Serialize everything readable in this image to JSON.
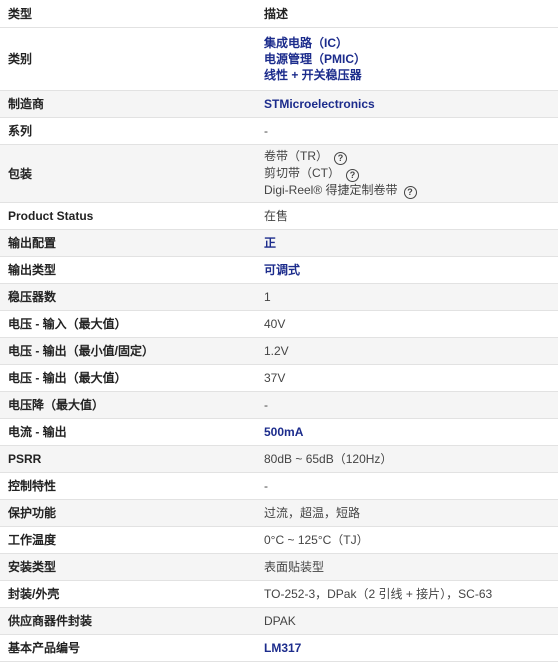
{
  "header": {
    "col1": "类型",
    "col2": "描述"
  },
  "rows": [
    {
      "label": "类别",
      "values": [
        "集成电路（IC）",
        "电源管理（PMIC）",
        "线性 + 开关稳压器"
      ]
    },
    {
      "label": "制造商",
      "value": "STMicroelectronics"
    },
    {
      "label": "系列",
      "value": "-"
    },
    {
      "label": "包装",
      "values": [
        "卷带（TR）",
        "剪切带（CT）",
        "Digi-Reel® 得捷定制卷带"
      ],
      "icon": "question-circle-icon"
    },
    {
      "label": "Product Status",
      "value": "在售"
    },
    {
      "label": "输出配置",
      "value": "正"
    },
    {
      "label": "输出类型",
      "value": "可调式"
    },
    {
      "label": "稳压器数",
      "value": "1"
    },
    {
      "label": "电压 - 输入（最大值）",
      "value": "40V"
    },
    {
      "label": "电压 - 输出（最小值/固定）",
      "value": "1.2V"
    },
    {
      "label": "电压 - 输出（最大值）",
      "value": "37V"
    },
    {
      "label": "电压降（最大值）",
      "value": "-"
    },
    {
      "label": "电流 - 输出",
      "value": "500mA"
    },
    {
      "label": "PSRR",
      "value": "80dB ~ 65dB（120Hz）"
    },
    {
      "label": "控制特性",
      "value": "-"
    },
    {
      "label": "保护功能",
      "value": "过流，超温，短路"
    },
    {
      "label": "工作温度",
      "value": "0°C ~ 125°C（TJ）"
    },
    {
      "label": "安装类型",
      "value": "表面贴装型"
    },
    {
      "label": "封装/外壳",
      "value": "TO-252-3，DPak（2 引线 + 接片），SC-63"
    },
    {
      "label": "供应商器件封装",
      "value": "DPAK"
    },
    {
      "label": "基本产品编号",
      "value": "LM317"
    }
  ],
  "colors": {
    "link": "#1c2c8c",
    "alt_row": "#f5f5f5"
  }
}
